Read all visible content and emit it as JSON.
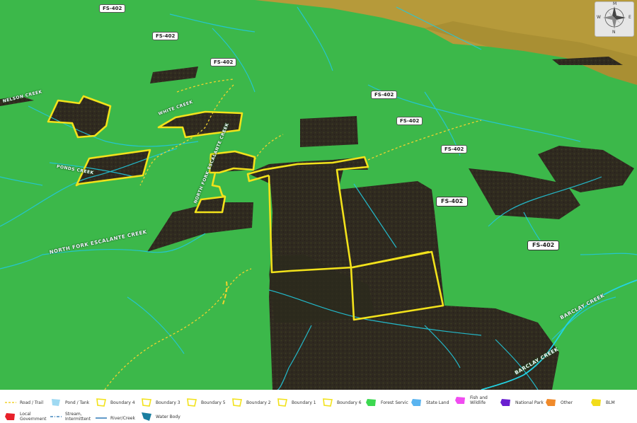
{
  "map": {
    "colors": {
      "forest_service": "#3cb84a",
      "private_land": "#2f2a20",
      "terrain": "#b69a3a",
      "stream": "#22c8dc",
      "boundary": "#f2e21b",
      "road": "#f2d22e"
    },
    "road_labels": [
      {
        "id": "fs402-a",
        "text": "FS-402"
      },
      {
        "id": "fs402-b",
        "text": "FS-402"
      },
      {
        "id": "fs402-c",
        "text": "FS-402"
      },
      {
        "id": "fs402-d",
        "text": "FS-402"
      },
      {
        "id": "fs402-e",
        "text": "FS-402"
      },
      {
        "id": "fs402-f",
        "text": "FS-402"
      },
      {
        "id": "fs402-g",
        "text": "FS-402"
      },
      {
        "id": "fs402-h",
        "text": "FS-402"
      }
    ],
    "creek_labels": [
      {
        "id": "north-fork-escalante",
        "text": "NORTH FORK ESCALANTE CREEK"
      },
      {
        "id": "north-fork-escalante-2",
        "text": "NORTH FORK ESCALANTE CREEK"
      },
      {
        "id": "barclay-creek",
        "text": "BARCLAY CREEK"
      },
      {
        "id": "barclay-creek-2",
        "text": "BARCLAY CREEK"
      },
      {
        "id": "ponds-creek",
        "text": "PONDS CREEK"
      },
      {
        "id": "white-creek",
        "text": "WHITE CREEK"
      },
      {
        "id": "nelson-creek",
        "text": "NELSON CREEK"
      }
    ],
    "compass": {
      "n": "N",
      "s": "N",
      "e": "E",
      "w": "W",
      "top": "M"
    }
  },
  "legend": {
    "items": [
      {
        "id": "road-trail",
        "label": "Road / Trail",
        "icon": "dashed-line-icon",
        "color": "#f2d22e"
      },
      {
        "id": "pond-tank",
        "label": "Pond / Tank",
        "icon": "polygon-icon",
        "color": "#9fd9f2"
      },
      {
        "id": "boundary-4",
        "label": "Boundary 4",
        "icon": "boundary-icon",
        "color": "#f2e21b"
      },
      {
        "id": "boundary-3",
        "label": "Boundary 3",
        "icon": "boundary-icon",
        "color": "#f2e21b"
      },
      {
        "id": "boundary-5",
        "label": "Boundary 5",
        "icon": "boundary-icon",
        "color": "#f2e21b"
      },
      {
        "id": "boundary-2",
        "label": "Boundary 2",
        "icon": "boundary-icon",
        "color": "#f2e21b"
      },
      {
        "id": "boundary-1",
        "label": "Boundary 1",
        "icon": "boundary-icon",
        "color": "#f2e21b"
      },
      {
        "id": "boundary-6",
        "label": "Boundary 6",
        "icon": "boundary-icon",
        "color": "#f2e21b"
      },
      {
        "id": "forest-service",
        "label": "Forest Servic",
        "icon": "polygon-icon",
        "color": "#3cd850"
      },
      {
        "id": "state-land",
        "label": "State Land",
        "icon": "polygon-icon",
        "color": "#5ab4f0"
      },
      {
        "id": "fish-wildlife",
        "label": "Fish and Wildlife",
        "icon": "polygon-icon",
        "color": "#f04cf0"
      },
      {
        "id": "national-park",
        "label": "National Park",
        "icon": "polygon-icon",
        "color": "#6a1fd0"
      },
      {
        "id": "other",
        "label": "Other",
        "icon": "polygon-icon",
        "color": "#f08a2a"
      },
      {
        "id": "blm",
        "label": "BLM",
        "icon": "polygon-icon",
        "color": "#f2dc1a"
      },
      {
        "id": "local-government",
        "label": "Local Government",
        "icon": "polygon-icon",
        "color": "#e8202a"
      },
      {
        "id": "stream-intermittent",
        "label": "Stream, Intermittent",
        "icon": "dashdot-line-icon",
        "color": "#1f6fb0"
      },
      {
        "id": "river-creek",
        "label": "River/Creek",
        "icon": "solid-line-icon",
        "color": "#1f6fb0"
      },
      {
        "id": "water-body",
        "label": "Water Body",
        "icon": "polygon-icon",
        "color": "#1a7ea0"
      }
    ]
  }
}
